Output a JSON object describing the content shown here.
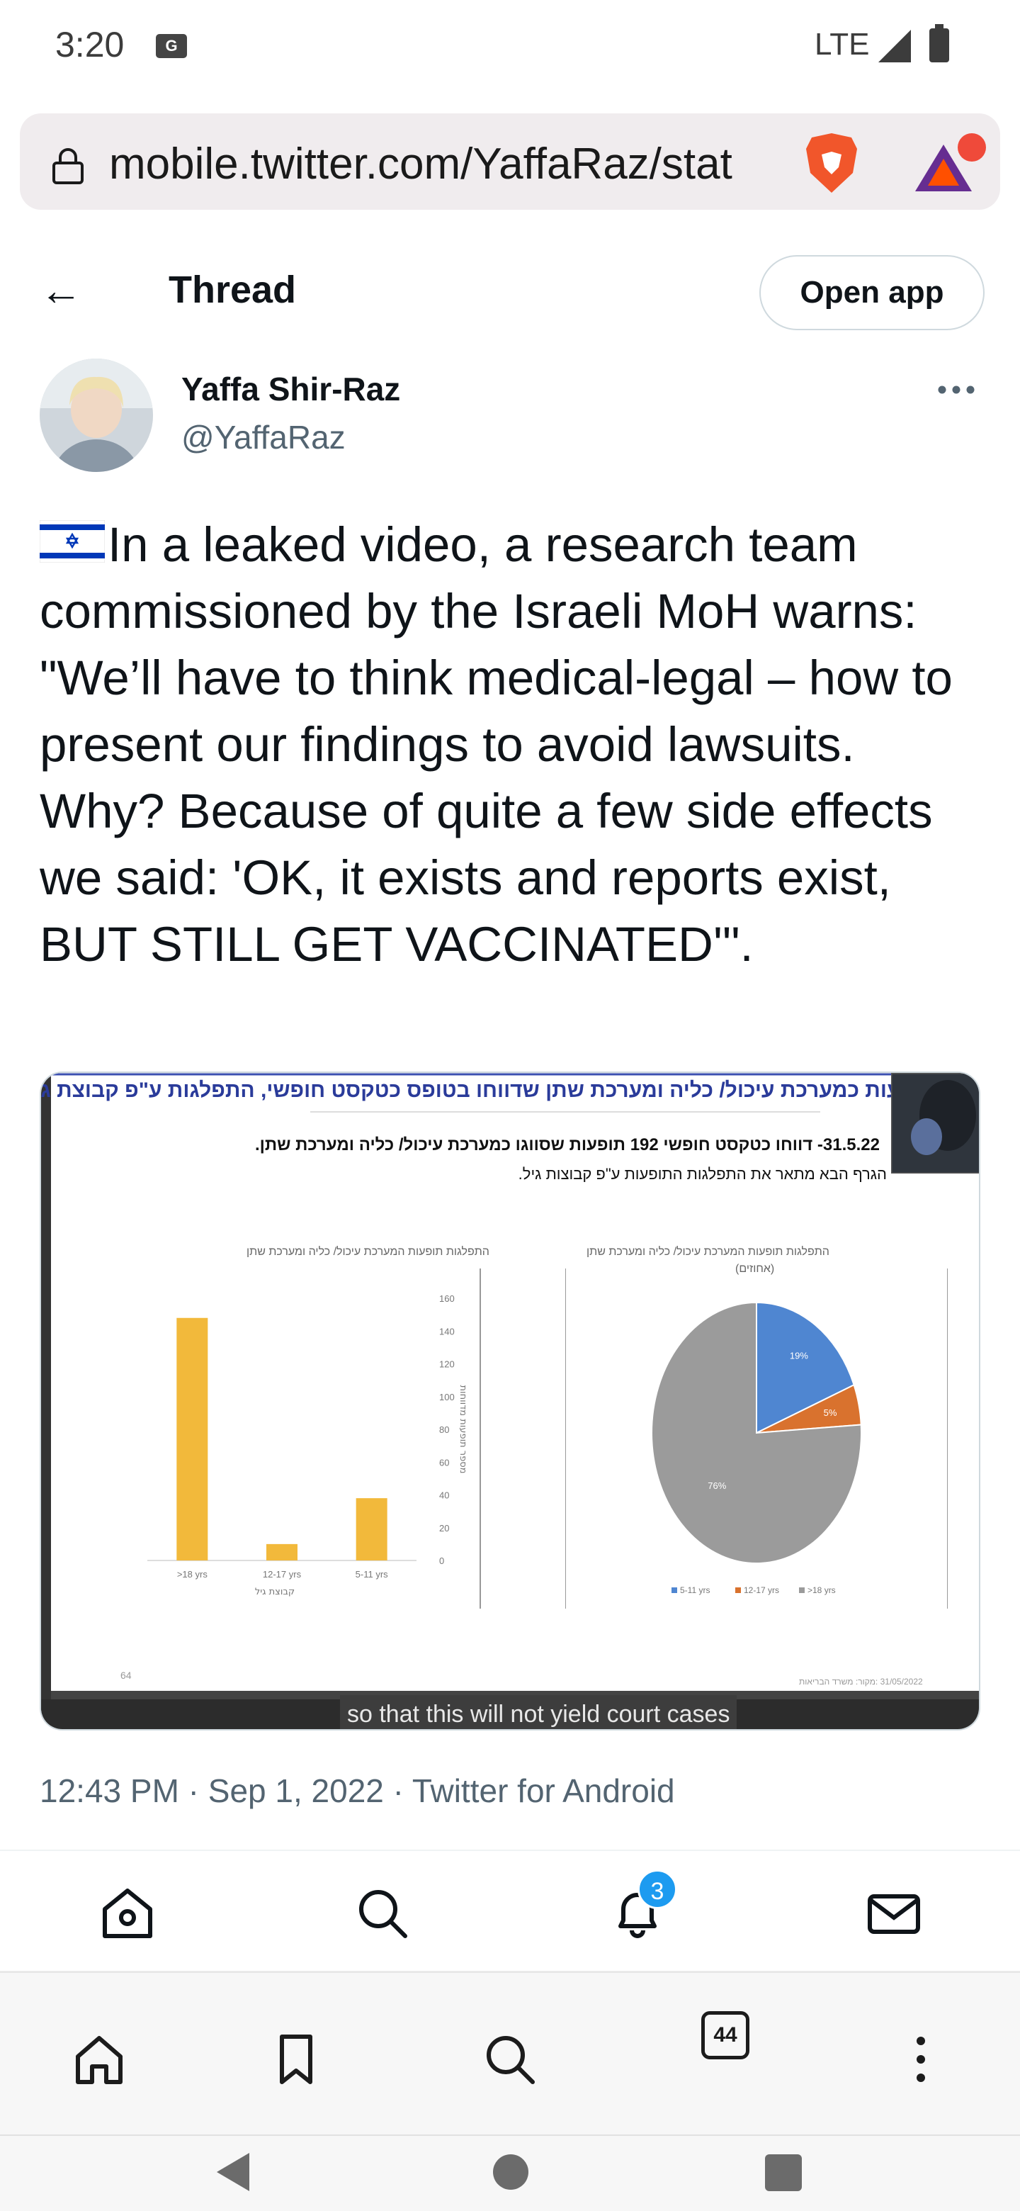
{
  "status_bar": {
    "time": "3:20",
    "network": "LTE"
  },
  "browser": {
    "url": "mobile.twitter.com/YaffaRaz/stat",
    "tab_count": "44"
  },
  "header": {
    "title": "Thread",
    "open_app_label": "Open app"
  },
  "tweet": {
    "author_name": "Yaffa Shir-Raz",
    "author_handle": "@YaffaRaz",
    "text": "In a leaked video, a research team commissioned by the Israeli MoH warns: \"We’ll have to think medical-legal – how to present our findings to avoid lawsuits. Why? Because of quite a few side effects we said: 'OK, it exists and reports exist, BUT STILL GET VACCINATED'\".",
    "meta": "12:43 PM · Sep 1, 2022 · Twitter for Android",
    "media": {
      "slide_heading": "פעות כמערכת עיכול/ כליה ומערכת שתן שדווחו בטופס כטקסט חופשי, התפלגות ע\"פ קבוצת גיל",
      "slide_sub1": "31.5.22- דווחו כטקסט חופשי 192 תופעות שסווגו כמערכת עיכול/ כליה ומערכת שתן.",
      "slide_sub2": "הגרף הבא מתאר את התפלגות התופעות ע\"פ קבוצות גיל.",
      "bar_chart_title": "התפלגות תופעות המערכת עיכול/ כליה ומערכת שתן",
      "bar_chart_ylabel": "מספר תופעות מדווחות",
      "bar_chart_xlabel": "קבוצת גיל",
      "pie_chart_title": "התפלגות תופעות המערכת עיכול/ כליה ומערכת שתן",
      "pie_chart_subtitle": "(אחוזים)",
      "page_number": "64",
      "footer": "31/05/2022 :מקור: משרד הבריאות",
      "caption": "so that this will not yield court cases"
    }
  },
  "nav": {
    "notification_count": "3"
  },
  "colors": {
    "bar": "#f2b93b",
    "pie_blue": "#4f86d1",
    "pie_orange": "#d9722e",
    "pie_gray": "#9b9b9b",
    "twitter_blue": "#1d9bf0"
  },
  "chart_data": [
    {
      "type": "bar",
      "categories": [
        ">18 yrs",
        "12-17 yrs",
        "5-11 yrs"
      ],
      "values": [
        148,
        10,
        38
      ],
      "ylim": [
        0,
        160
      ],
      "yticks": [
        0,
        20,
        40,
        60,
        80,
        100,
        120,
        140,
        160
      ]
    },
    {
      "type": "pie",
      "labels": [
        "5-11 yrs",
        "12-17 yrs",
        ">18 yrs"
      ],
      "values": [
        19,
        5,
        76
      ],
      "data_labels": [
        "19%",
        "5%",
        "76%"
      ]
    }
  ]
}
